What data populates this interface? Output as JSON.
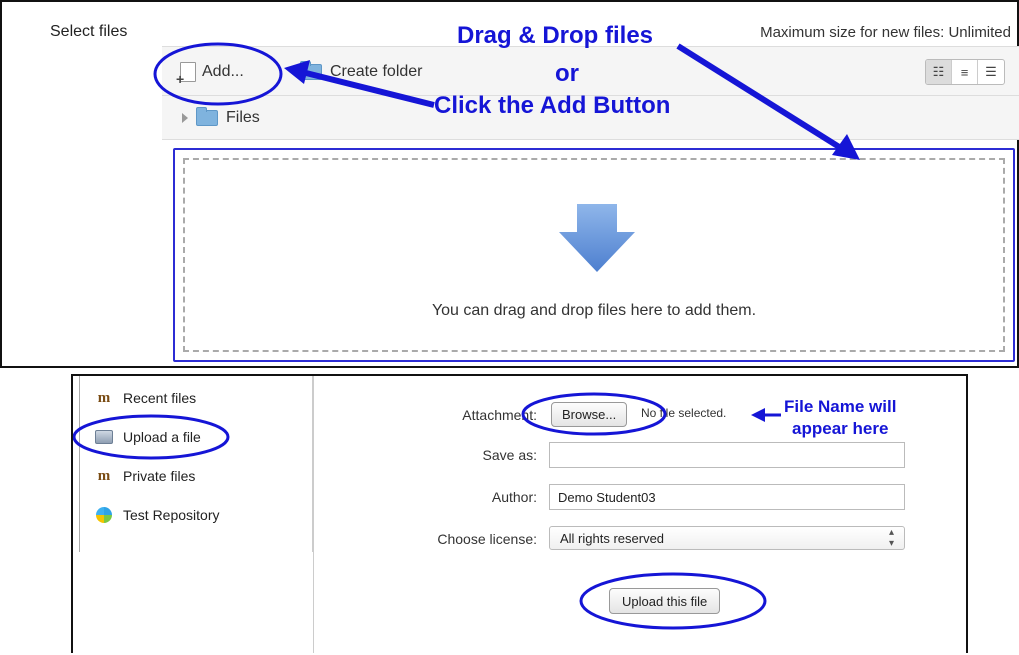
{
  "top": {
    "select_files_label": "Select files",
    "max_size": "Maximum size for new files: Unlimited",
    "toolbar": {
      "add_label": "Add...",
      "create_folder_label": "Create folder",
      "views": [
        "icons-view-icon",
        "list-view-icon",
        "tree-view-icon"
      ],
      "active_view": "icons-view-icon"
    },
    "path": {
      "folder_label": "Files"
    },
    "dropzone": {
      "message": "You can drag and drop files here to add them."
    },
    "annotations": {
      "drag_drop": "Drag & Drop files",
      "or": "or",
      "click_add": "Click the Add Button"
    }
  },
  "bottom": {
    "repositories": [
      {
        "label": "Recent files",
        "icon": "moodle-icon"
      },
      {
        "label": "Upload a file",
        "icon": "upload-icon"
      },
      {
        "label": "Private files",
        "icon": "moodle-icon"
      },
      {
        "label": "Test Repository",
        "icon": "test-repository-icon"
      }
    ],
    "form": {
      "attachment_label": "Attachment:",
      "browse_label": "Browse...",
      "no_file_text": "No file selected.",
      "save_as_label": "Save as:",
      "save_as_value": "",
      "author_label": "Author:",
      "author_value": "Demo Student03",
      "license_label": "Choose license:",
      "license_value": "All rights reserved",
      "upload_button": "Upload this file"
    },
    "annotations": {
      "file_name_line1": "File Name will",
      "file_name_line2": "appear here"
    }
  },
  "colors": {
    "annotation": "#1515d6",
    "dropzone_arrow": "#5b8fd9",
    "folder": "#7fb3de"
  }
}
